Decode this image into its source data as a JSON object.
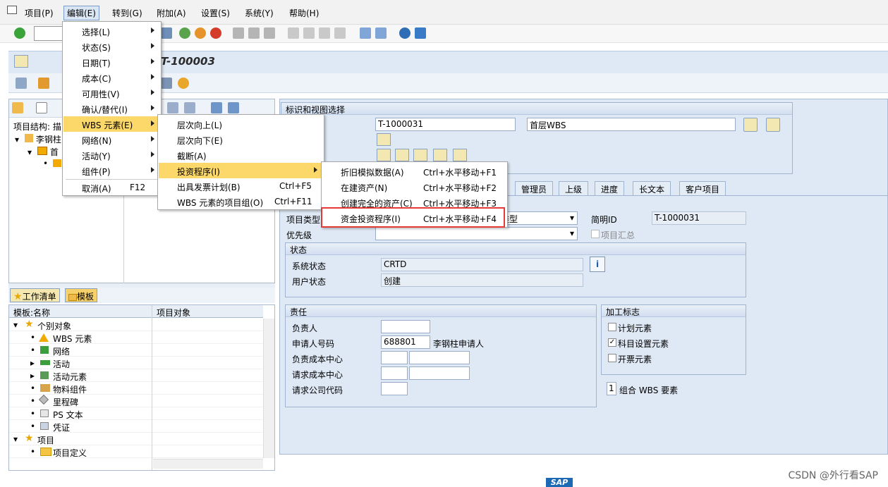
{
  "menubar": {
    "items": [
      "项目(P)",
      "编辑(E)",
      "转到(G)",
      "附加(A)",
      "设置(S)",
      "系统(Y)",
      "帮助(H)"
    ]
  },
  "title": {
    "text": "T-100003"
  },
  "edit_menu": {
    "items": [
      {
        "label": "选择(L)"
      },
      {
        "label": "状态(S)"
      },
      {
        "label": "日期(T)"
      },
      {
        "label": "成本(C)"
      },
      {
        "label": "可用性(V)"
      },
      {
        "label": "确认/替代(I)"
      },
      {
        "label": "WBS 元素(E)"
      },
      {
        "label": "网络(N)"
      },
      {
        "label": "活动(Y)"
      },
      {
        "label": "组件(P)"
      },
      {
        "label": "取消(A)",
        "shortcut": "F12"
      }
    ]
  },
  "wbs_submenu": {
    "items": [
      {
        "label": "层次向上(L)",
        "shortcut": ""
      },
      {
        "label": "层次向下(E)",
        "shortcut": ""
      },
      {
        "label": "截断(A)",
        "shortcut": ""
      },
      {
        "label": "投资程序(I)",
        "shortcut": ""
      },
      {
        "label": "出具发票计划(B)",
        "shortcut": "Ctrl+F5"
      },
      {
        "label": "WBS 元素的项目组(O)",
        "shortcut": "Ctrl+F11"
      }
    ]
  },
  "invest_submenu": {
    "items": [
      {
        "label": "折旧模拟数据(A)",
        "shortcut": "Ctrl+水平移动+F1"
      },
      {
        "label": "在建资产(N)",
        "shortcut": "Ctrl+水平移动+F2"
      },
      {
        "label": "创建完全的资产(C)",
        "shortcut": "Ctrl+水平移动+F3"
      },
      {
        "label": "资金投资程序(I)",
        "shortcut": "Ctrl+水平移动+F4"
      }
    ]
  },
  "left": {
    "structure_label": "项目结构: 描",
    "tree": [
      "李钢柱",
      "首"
    ],
    "tabs": [
      "工作清单",
      "模板"
    ],
    "grid_headers": [
      "模板:名称",
      "项目对象"
    ],
    "grid_rows": [
      "个别对象",
      "WBS 元素",
      "网络",
      "活动",
      "活动元素",
      "物料组件",
      "里程碑",
      "PS 文本",
      "凭证",
      "项目",
      "项目定义"
    ]
  },
  "right": {
    "group_title": "标识和视图选择",
    "wbs_id": "T-1000031",
    "wbs_name": "首层WBS",
    "tabs": [
      "管理员",
      "上级",
      "进度",
      "长文本",
      "客户项目"
    ],
    "project_type_label": "项目类型",
    "project_type_value": "类型",
    "short_id_label": "简明ID",
    "short_id_value": "T-1000031",
    "priority_label": "优先级",
    "project_summary_label": "项目汇总",
    "status": {
      "title": "状态",
      "sys_label": "系统状态",
      "sys_value": "CRTD",
      "user_label": "用户状态",
      "user_value": "创建"
    },
    "resp": {
      "title": "责任",
      "owner_label": "负责人",
      "req_label": "申请人号码",
      "req_value": "688801",
      "req_name": "李钢柱申请人",
      "cc_label": "负责成本中心",
      "req_cc_label": "请求成本中心",
      "req_co_label": "请求公司代码"
    },
    "proc": {
      "title": "加工标志",
      "plan_label": "计划元素",
      "acct_label": "科目设置元素",
      "bill_label": "开票元素",
      "group_count": "1",
      "group_label": "组合 WBS 要素"
    }
  },
  "footer": {
    "watermark": "CSDN @外行看SAP",
    "logo": "SAP"
  },
  "colors": {
    "menu_highlight": "#fbd869",
    "red_box": "#e53935",
    "pane_bg": "#dfe9f5"
  }
}
